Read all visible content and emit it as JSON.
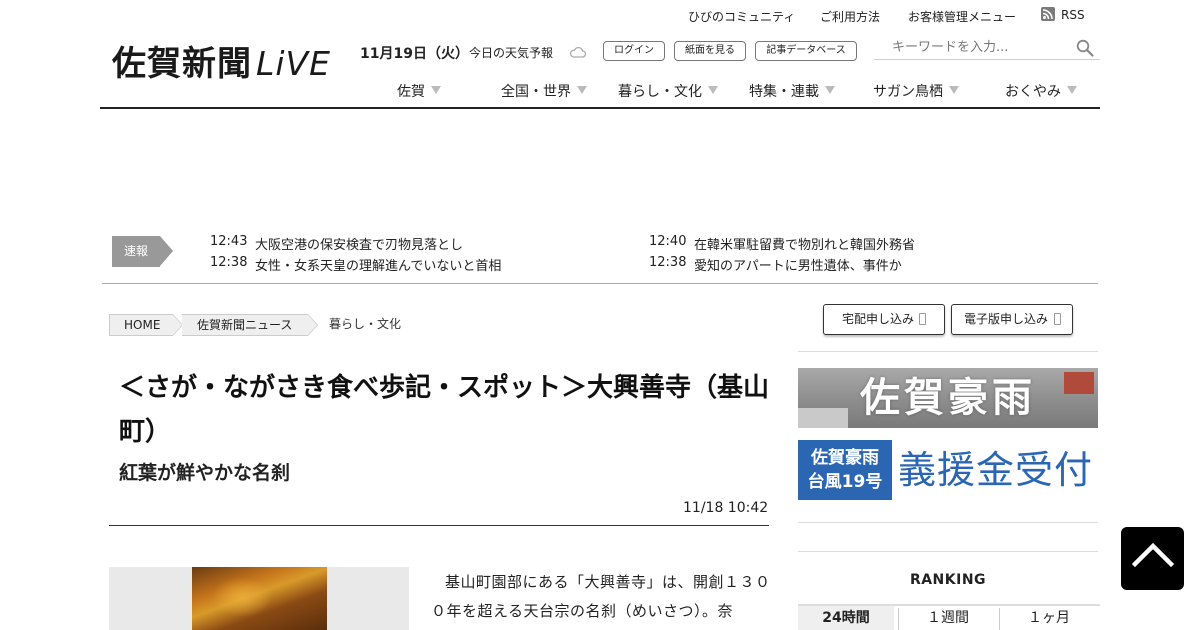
{
  "utility_links": {
    "community": "ひびのコミュニティ",
    "usage": "ご利用方法",
    "customer": "お客様管理メニュー",
    "rss": "RSS"
  },
  "logo": {
    "name": "佐賀新聞",
    "live": "LiVE"
  },
  "header": {
    "date": "11月19日（火）",
    "weather": "今日の天気予報",
    "weather_icon": "cloud-icon",
    "login": "ログイン",
    "paper": "紙面を見る",
    "database": "記事データベース",
    "search_placeholder": "キーワードを入力..."
  },
  "nav": [
    {
      "label": "佐賀"
    },
    {
      "label": "全国・世界"
    },
    {
      "label": "暮らし・文化"
    },
    {
      "label": "特集・連載"
    },
    {
      "label": "サガン鳥栖"
    },
    {
      "label": "おくやみ"
    }
  ],
  "breaking": {
    "label": "速報",
    "items": [
      {
        "time": "12:43",
        "title": "大阪空港の保安検査で刃物見落とし"
      },
      {
        "time": "12:40",
        "title": "在韓米軍駐留費で物別れと韓国外務省"
      },
      {
        "time": "12:38",
        "title": "女性・女系天皇の理解進んでいないと首相"
      },
      {
        "time": "12:38",
        "title": "愛知のアパートに男性遺体、事件か"
      }
    ]
  },
  "breadcrumb": {
    "home": "HOME",
    "news": "佐賀新聞ニュース",
    "current": "暮らし・文化"
  },
  "subscribe": {
    "home_delivery": "宅配申し込み",
    "digital": "電子版申し込み"
  },
  "article": {
    "title": "＜さが・ながさき食べ歩記・スポット＞大興善寺（基山町）",
    "subtitle": "紅葉が鮮やかな名刹",
    "datetime": "11/18 10:42",
    "body": "基山町園部にある「大興善寺」は、開創１３００年を超える天台宗の名刹（めいさつ）。奈"
  },
  "sidebar": {
    "banner1": "佐賀豪雨",
    "banner2_box": [
      "佐賀豪雨",
      "台風19号"
    ],
    "banner2_text": "義援金受付",
    "ranking_title": "RANKING",
    "ranking_tabs": [
      "24時間",
      "１週間",
      "１ヶ月"
    ],
    "ranking_active": 0
  },
  "colors": {
    "banner_blue": "#2b66b3",
    "breaking_label_bg": "#999999",
    "header_rule": "#222222"
  }
}
